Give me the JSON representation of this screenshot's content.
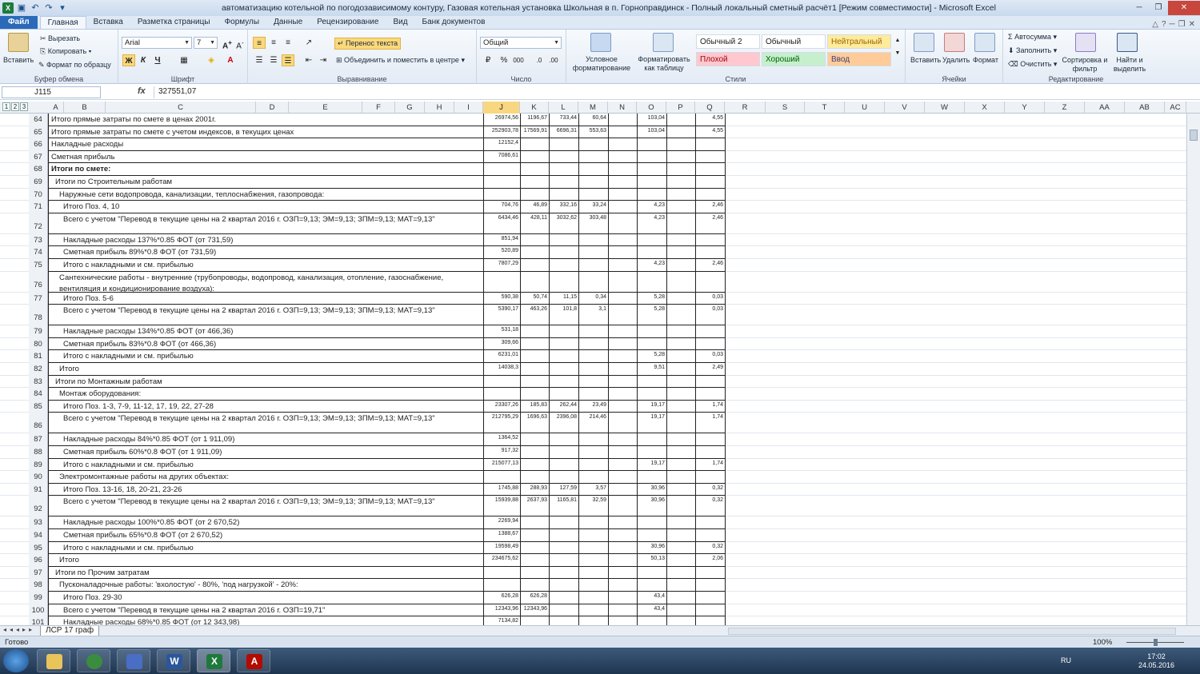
{
  "title": "автоматизацию котельной по погодозависимому контуру, Газовая котельная установка Школьная в п. Горноправдинск - Полный локальный сметный расчёт1  [Режим совместимости] - Microsoft Excel",
  "tabs": [
    "Файл",
    "Главная",
    "Вставка",
    "Разметка страницы",
    "Формулы",
    "Данные",
    "Рецензирование",
    "Вид",
    "Банк документов"
  ],
  "ribbon": {
    "clipboard": {
      "paste": "Вставить",
      "cut": "Вырезать",
      "copy": "Копировать",
      "format_painter": "Формат по образцу",
      "label": "Буфер обмена"
    },
    "font": {
      "name": "Arial",
      "size": "7",
      "label": "Шрифт",
      "bold": "Ж",
      "italic": "К",
      "underline": "Ч"
    },
    "alignment": {
      "wrap": "Перенос текста",
      "merge": "Объединить и поместить в центре",
      "label": "Выравнивание"
    },
    "number": {
      "format": "Общий",
      "label": "Число"
    },
    "styles": {
      "conditional": "Условное форматирование",
      "as_table": "Форматировать как таблицу",
      "label": "Стили",
      "cells": [
        {
          "name": "Обычный 2",
          "bg": "#ffffff",
          "fg": "#222222"
        },
        {
          "name": "Обычный",
          "bg": "#ffffff",
          "fg": "#222222"
        },
        {
          "name": "Нейтральный",
          "bg": "#ffeb9c",
          "fg": "#9c6500"
        },
        {
          "name": "Плохой",
          "bg": "#ffc7ce",
          "fg": "#9c0006"
        },
        {
          "name": "Хороший",
          "bg": "#c6efce",
          "fg": "#006100"
        },
        {
          "name": "Ввод",
          "bg": "#ffcc99",
          "fg": "#3f3f76"
        }
      ]
    },
    "cells": {
      "insert": "Вставить",
      "delete": "Удалить",
      "format": "Формат",
      "label": "Ячейки"
    },
    "editing": {
      "autosum": "Автосумма",
      "fill": "Заполнить",
      "clear": "Очистить",
      "sort": "Сортировка и фильтр",
      "find": "Найти и выделить",
      "label": "Редактирование"
    }
  },
  "formula_bar": {
    "name_box": "J115",
    "fx": "fx",
    "value": "327551,07"
  },
  "outline_levels": [
    "1",
    "2",
    "3"
  ],
  "columns": [
    "A",
    "B",
    "C",
    "D",
    "E",
    "F",
    "G",
    "H",
    "I",
    "J",
    "K",
    "L",
    "M",
    "N",
    "O",
    "P",
    "Q",
    "R",
    "S",
    "T",
    "U",
    "V",
    "W",
    "X",
    "Y",
    "Z",
    "AA",
    "AB",
    "AC"
  ],
  "selected_column": "J",
  "rows": [
    {
      "n": "64",
      "text": "Итого прямые затраты по смете в ценах 2001г.",
      "J": "26974,56",
      "K": "1196,67",
      "L": "733,44",
      "M": "60,64",
      "O": "103,04",
      "Q": "4,55"
    },
    {
      "n": "65",
      "text": "Итого прямые затраты по смете с учетом индексов, в текущих ценах",
      "J": "252903,78",
      "K": "17569,91",
      "L": "6696,31",
      "M": "553,63",
      "O": "103,04",
      "Q": "4,55"
    },
    {
      "n": "66",
      "text": "Накладные расходы",
      "J": "12152,4"
    },
    {
      "n": "67",
      "text": "Сметная прибыль",
      "J": "7086,61"
    },
    {
      "n": "68",
      "text": "Итоги по смете:",
      "bold": true
    },
    {
      "n": "69",
      "text": "Итоги по Строительным работам",
      "indent": 1
    },
    {
      "n": "70",
      "text": "Наружные сети водопровода, канализации, теплоснабжения, газопровода:",
      "indent": 2
    },
    {
      "n": "71",
      "text": "Итого Поз. 4, 10",
      "indent": 3,
      "J": "704,76",
      "K": "46,89",
      "L": "332,16",
      "M": "33,24",
      "O": "4,23",
      "Q": "2,46"
    },
    {
      "n": "72",
      "text": "Всего с учетом \"Перевод в текущие цены на 2 квартал 2016 г. ОЗП=9,13; ЭМ=9,13; ЗПМ=9,13; МАТ=9,13\"",
      "indent": 3,
      "tall": true,
      "J": "6434,46",
      "K": "428,11",
      "L": "3032,62",
      "M": "303,48",
      "O": "4,23",
      "Q": "2,46"
    },
    {
      "n": "73",
      "text": "Накладные расходы 137%*0.85 ФОТ (от 731,59)",
      "indent": 3,
      "J": "851,94"
    },
    {
      "n": "74",
      "text": "Сметная прибыль 89%*0.8 ФОТ (от 731,59)",
      "indent": 3,
      "J": "520,89"
    },
    {
      "n": "75",
      "text": "Итого с накладными и см. прибылью",
      "indent": 3,
      "J": "7807,29",
      "O": "4,23",
      "Q": "2,46"
    },
    {
      "n": "76",
      "text": "Сантехнические работы - внутренние (трубопроводы, водопровод, канализация, отопление, газоснабжение, вентиляция и кондиционирование воздуха):",
      "indent": 2,
      "tall": true,
      "wrap": true
    },
    {
      "n": "77",
      "text": "Итого Поз. 5-6",
      "indent": 3,
      "J": "590,38",
      "K": "50,74",
      "L": "11,15",
      "M": "0,34",
      "O": "5,28",
      "Q": "0,03"
    },
    {
      "n": "78",
      "text": "Всего с учетом \"Перевод в текущие цены на 2 квартал 2016 г. ОЗП=9,13; ЭМ=9,13; ЗПМ=9,13; МАТ=9,13\"",
      "indent": 3,
      "tall": true,
      "J": "5390,17",
      "K": "463,26",
      "L": "101,8",
      "M": "3,1",
      "O": "5,28",
      "Q": "0,03"
    },
    {
      "n": "79",
      "text": "Накладные расходы 134%*0.85 ФОТ (от 466,36)",
      "indent": 3,
      "J": "531,18"
    },
    {
      "n": "80",
      "text": "Сметная прибыль 83%*0.8 ФОТ (от 466,36)",
      "indent": 3,
      "J": "309,66"
    },
    {
      "n": "81",
      "text": "Итого с накладными и см. прибылью",
      "indent": 3,
      "J": "6231,01",
      "O": "5,28",
      "Q": "0,03"
    },
    {
      "n": "82",
      "text": "Итого",
      "indent": 2,
      "J": "14038,3",
      "O": "9,51",
      "Q": "2,49"
    },
    {
      "n": "83",
      "text": "Итоги по Монтажным работам",
      "indent": 1
    },
    {
      "n": "84",
      "text": "Монтаж оборудования:",
      "indent": 2
    },
    {
      "n": "85",
      "text": "Итого Поз. 1-3, 7-9, 11-12, 17, 19, 22, 27-28",
      "indent": 3,
      "J": "23307,26",
      "K": "185,83",
      "L": "262,44",
      "M": "23,49",
      "O": "19,17",
      "Q": "1,74"
    },
    {
      "n": "86",
      "text": "Всего с учетом \"Перевод в текущие цены на 2 квартал 2016 г. ОЗП=9,13; ЭМ=9,13; ЗПМ=9,13; МАТ=9,13\"",
      "indent": 3,
      "tall": true,
      "J": "212795,29",
      "K": "1696,63",
      "L": "2396,08",
      "M": "214,46",
      "O": "19,17",
      "Q": "1,74"
    },
    {
      "n": "87",
      "text": "Накладные расходы 84%*0.85 ФОТ (от 1 911,09)",
      "indent": 3,
      "J": "1364,52"
    },
    {
      "n": "88",
      "text": "Сметная прибыль 60%*0.8 ФОТ (от 1 911,09)",
      "indent": 3,
      "J": "917,32"
    },
    {
      "n": "89",
      "text": "Итого с накладными и см. прибылью",
      "indent": 3,
      "J": "215077,13",
      "O": "19,17",
      "Q": "1,74"
    },
    {
      "n": "90",
      "text": "Электромонтажные работы на других объектах:",
      "indent": 2
    },
    {
      "n": "91",
      "text": "Итого Поз. 13-16, 18, 20-21, 23-26",
      "indent": 3,
      "J": "1745,88",
      "K": "288,93",
      "L": "127,59",
      "M": "3,57",
      "O": "30,96",
      "Q": "0,32"
    },
    {
      "n": "92",
      "text": "Всего с учетом \"Перевод в текущие цены на 2 квартал 2016 г. ОЗП=9,13; ЭМ=9,13; ЗПМ=9,13; МАТ=9,13\"",
      "indent": 3,
      "tall": true,
      "J": "15939,88",
      "K": "2637,93",
      "L": "1165,81",
      "M": "32,59",
      "O": "30,96",
      "Q": "0,32"
    },
    {
      "n": "93",
      "text": "Накладные расходы 100%*0.85 ФОТ (от 2 670,52)",
      "indent": 3,
      "J": "2269,94"
    },
    {
      "n": "94",
      "text": "Сметная прибыль 65%*0.8 ФОТ (от 2 670,52)",
      "indent": 3,
      "J": "1388,67"
    },
    {
      "n": "95",
      "text": "Итого с накладными и см. прибылью",
      "indent": 3,
      "J": "19598,49",
      "O": "30,96",
      "Q": "0,32"
    },
    {
      "n": "96",
      "text": "Итого",
      "indent": 2,
      "J": "234675,62",
      "O": "50,13",
      "Q": "2,06"
    },
    {
      "n": "97",
      "text": "Итоги по Прочим затратам",
      "indent": 1
    },
    {
      "n": "98",
      "text": "Пусконаладочные работы: 'вхолостую' - 80%, 'под нагрузкой' - 20%:",
      "indent": 2
    },
    {
      "n": "99",
      "text": "Итого Поз. 29-30",
      "indent": 3,
      "J": "626,28",
      "K": "626,28",
      "O": "43,4"
    },
    {
      "n": "100",
      "text": "Всего с учетом \"Перевод в текущие цены на 2 квартал 2016 г. ОЗП=19,71\"",
      "indent": 3,
      "J": "12343,96",
      "K": "12343,96",
      "O": "43,4"
    },
    {
      "n": "101",
      "text": "Накладные расходы 68%*0.85 ФОТ (от 12 343,98)",
      "indent": 3,
      "J": "7134,82"
    }
  ],
  "sheet_tab": "ЛСР 17 граф",
  "status": {
    "ready": "Готово",
    "zoom": "100%"
  },
  "tray": {
    "lang": "RU",
    "time": "17:02",
    "date": "24.05.2016"
  },
  "taskbar_apps": [
    "explorer",
    "chrome",
    "app",
    "word",
    "excel",
    "acrobat"
  ]
}
